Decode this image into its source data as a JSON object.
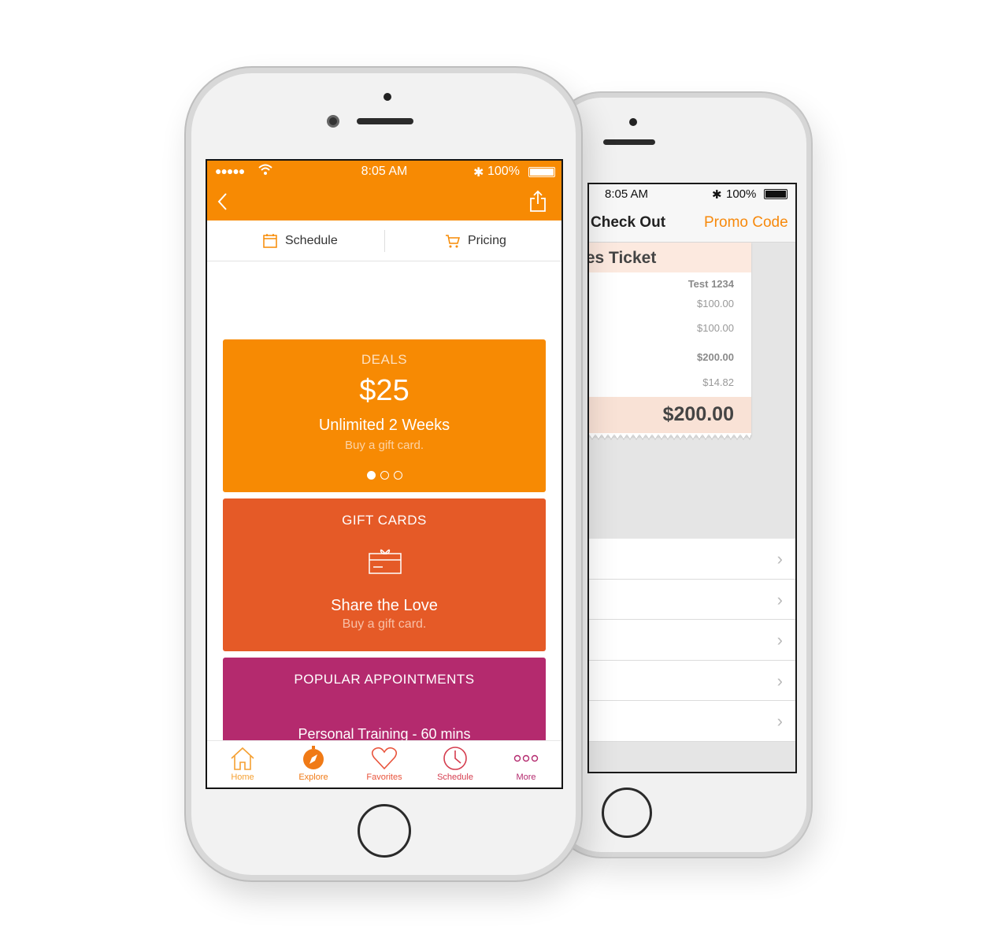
{
  "back_phone": {
    "status": {
      "time": "8:05 AM",
      "battery": "100%"
    },
    "nav": {
      "title": "Check Out",
      "promo_label": "Promo Code"
    },
    "ticket": {
      "heading": "les Ticket",
      "rows": [
        "Test 1234",
        "$100.00",
        "$100.00",
        "$200.00",
        "$14.82"
      ],
      "total": "$200.00"
    },
    "list_rows": 5
  },
  "front_phone": {
    "status": {
      "signal": "●●●●●",
      "time": "8:05 AM",
      "battery": "100%"
    },
    "top_tabs": {
      "schedule": "Schedule",
      "pricing": "Pricing"
    },
    "cards": {
      "deals": {
        "title": "DEALS",
        "price": "$25",
        "name": "Unlimited 2 Weeks",
        "subtitle": "Buy a gift card.",
        "color": "#f78a03"
      },
      "gift": {
        "title": "GIFT CARDS",
        "name": "Share the Love",
        "subtitle": "Buy a gift card.",
        "color": "#e55a27"
      },
      "popular": {
        "title": "POPULAR APPOINTMENTS",
        "name": "Personal Training - 60 mins",
        "color": "#b42a6e"
      }
    },
    "bottom_tabs": [
      {
        "label": "Home",
        "icon": "home-icon",
        "color": "#f5a032"
      },
      {
        "label": "Explore",
        "icon": "compass-icon",
        "color": "#f07a16"
      },
      {
        "label": "Favorites",
        "icon": "heart-icon",
        "color": "#e9533b"
      },
      {
        "label": "Schedule",
        "icon": "clock-icon",
        "color": "#d53d4f"
      },
      {
        "label": "More",
        "icon": "more-icon",
        "color": "#b42a6e"
      }
    ]
  }
}
